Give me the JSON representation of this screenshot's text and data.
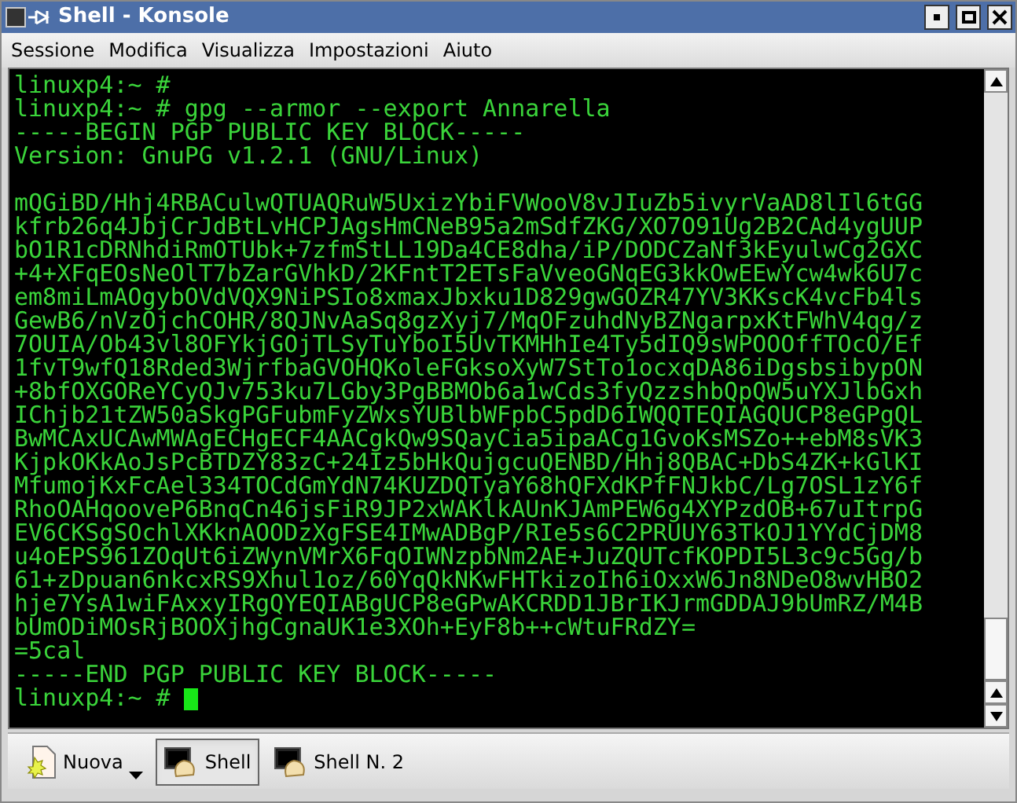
{
  "window": {
    "title": "Shell - Konsole"
  },
  "menu": [
    "Sessione",
    "Modifica",
    "Visualizza",
    "Impostazioni",
    "Aiuto"
  ],
  "terminal": {
    "lines": [
      "linuxp4:~ #",
      "linuxp4:~ # gpg --armor --export Annarella",
      "-----BEGIN PGP PUBLIC KEY BLOCK-----",
      "Version: GnuPG v1.2.1 (GNU/Linux)"
    ],
    "key_lines": [
      "mQGiBD/Hhj4RBACulwQTUAQRuW5UxizYbiFVWooV8vJIuZb5ivyrVaAD8lIl6tGG",
      "kfrb26q4JbjCrJdBtLvHCPJAgsHmCNeB95a2mSdfZKG/XO7O91Ug2B2CAd4ygUUP",
      "bO1R1cDRNhdiRmOTUbk+7zfmStLL19Da4CE8dha/iP/DODCZaNf3kEyulwCg2GXC",
      "+4+XFqEOsNeOlT7bZarGVhkD/2KFntT2ETsFaVveoGNqEG3kkOwEEwYcw4wk6U7c",
      "em8miLmAOgybOVdVQX9NiPSIo8xmaxJbxku1D829gwGOZR47YV3KKscK4vcFb4ls",
      "GewB6/nVzOjchCOHR/8QJNvAaSq8gzXyj7/MqOFzuhdNyBZNgarpxKtFWhV4qg/z",
      "7OUIA/Ob43vl8OFYkjGOjTLSyTuYboI5UvTKMHhIe4Ty5dIQ9sWPOOOffTOcO/Ef",
      "1fvT9wfQ18Rded3WjrfbaGVOHQKoleFGksoXyW7StTo1ocxqDA86iDgsbsibypON",
      "+8bfOXGOReYCyQJv753ku7LGby3PgBBMOb6a1wCds3fyQzzshbQpQW5uYXJlbGxh",
      "IChjb21tZW50aSkgPGFubmFyZWxsYUBlbWFpbC5pdD6IWQQTEQIAGQUCP8eGPgQL",
      "BwMCAxUCAwMWAgECHgECF4AACgkQw9SQayCia5ipaACg1GvoKsMSZo++ebM8sVK3",
      "KjpkOKkAoJsPcBTDZY83zC+24Iz5bHkQujgcuQENBD/Hhj8QBAC+DbS4ZK+kGlKI",
      "MfumojKxFcAel334TOCdGmYdN74KUZDQTyaY68hQFXdKPfFNJkbC/Lg7OSL1zY6f",
      "RhoOAHqooveP6BnqCn46jsFiR9JP2xWAKlkAUnKJAmPEW6g4XYPzdOB+67uItrpG",
      "EV6CKSgSOchlXKknAOODzXgFSE4IMwADBgP/RIe5s6C2PRUUY63TkOJ1YYdCjDM8",
      "u4oEPS961ZOqUt6iZWynVMrX6FqOIWNzpbNm2AE+JuZQUTcfKOPDI5L3c9c5Gg/b",
      "61+zDpuan6nkcxRS9Xhul1oz/60YqQkNKwFHTkizoIh6iOxxW6Jn8NDeO8wvHBO2",
      "hje7YsA1wiFAxxyIRgQYEQIABgUCP8eGPwAKCRDD1JBrIKJrmGDDAJ9bUmRZ/M4B",
      "bUmODiMOsRjBOOXjhgCgnaUK1e3XOh+EyF8b++cWtuFRdZY=",
      "=5cal",
      "-----END PGP PUBLIC KEY BLOCK-----",
      "linuxp4:~ #"
    ],
    "cursor": true
  },
  "sessions": [
    {
      "kind": "new",
      "label": "Nuova",
      "selected": false
    },
    {
      "kind": "shell",
      "label": "Shell",
      "selected": true
    },
    {
      "kind": "shell",
      "label": "Shell N. 2",
      "selected": false
    }
  ]
}
